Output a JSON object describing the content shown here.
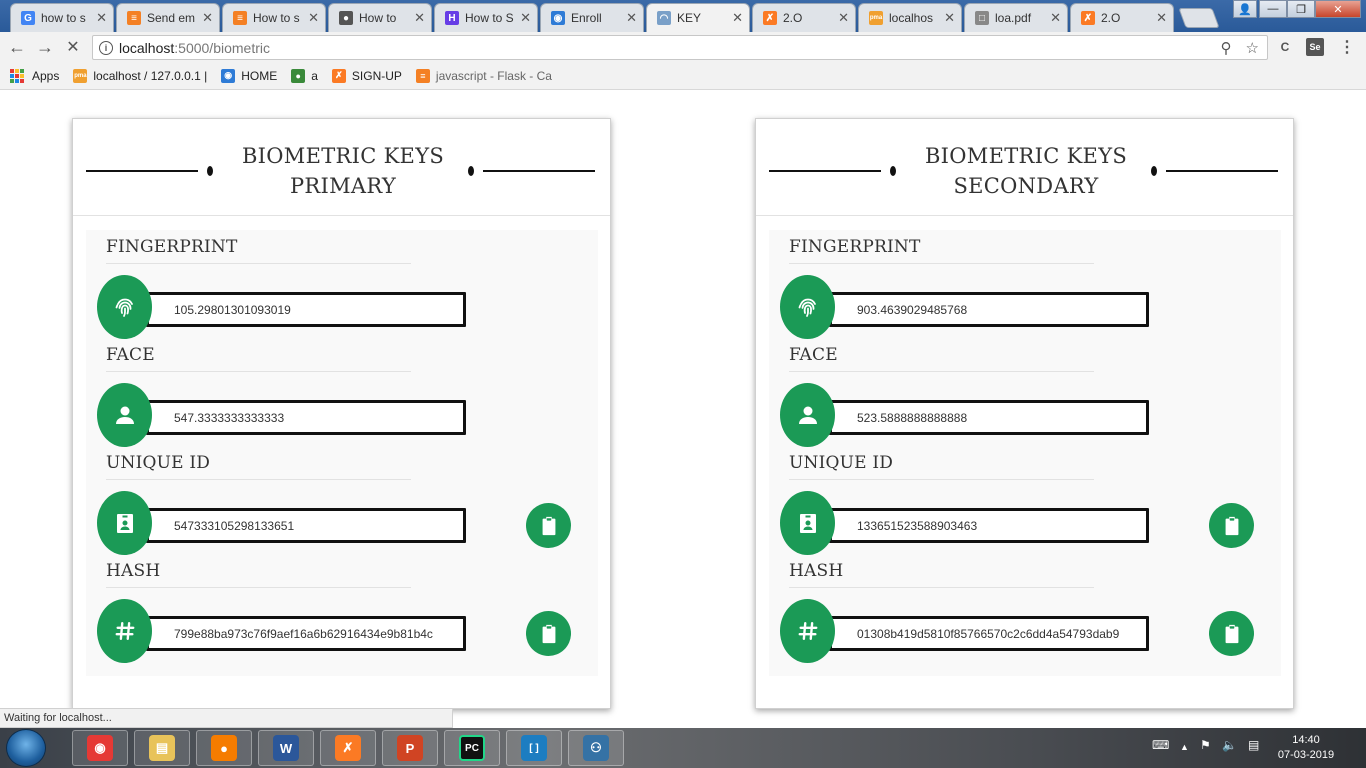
{
  "browser": {
    "tabs": [
      {
        "label": "how to s",
        "icon": "google-icon",
        "color": "#4285f4"
      },
      {
        "label": "Send em",
        "icon": "stackoverflow-icon",
        "color": "#f48024"
      },
      {
        "label": "How to s",
        "icon": "stackoverflow-icon",
        "color": "#f48024"
      },
      {
        "label": "How to",
        "icon": "github-icon",
        "color": "#555555"
      },
      {
        "label": "How to S",
        "icon": "hostinger-icon",
        "color": "#673de6"
      },
      {
        "label": "Enroll",
        "icon": "chrome-icon",
        "color": "#2e7bd6"
      },
      {
        "label": "KEY",
        "icon": "loading-icon",
        "color": "#7aa0c8"
      },
      {
        "label": "2.O",
        "icon": "xampp-icon",
        "color": "#fb7a24"
      },
      {
        "label": "localhos",
        "icon": "phpmyadmin-icon",
        "color": "#f0a030"
      },
      {
        "label": "loa.pdf",
        "icon": "document-icon",
        "color": "#888888"
      },
      {
        "label": "2.O",
        "icon": "xampp-icon",
        "color": "#fb7a24"
      }
    ],
    "active_tab_index": 6,
    "url_host": "localhost",
    "url_path": ":5000/biometric",
    "bookmarks": [
      {
        "label": "Apps",
        "icon": "apps-grid-icon"
      },
      {
        "label": "localhost / 127.0.0.1 |",
        "icon": "phpmyadmin-icon"
      },
      {
        "label": "HOME",
        "icon": "chrome-icon"
      },
      {
        "label": "a",
        "icon": "globe-icon"
      },
      {
        "label": "SIGN-UP",
        "icon": "xampp-icon"
      },
      {
        "label": "javascript - Flask - Ca",
        "icon": "stackoverflow-icon"
      }
    ]
  },
  "page": {
    "accent_color": "#1b9a56",
    "cards": [
      {
        "title": "BIOMETRIC KEYS PRIMARY",
        "sections": [
          {
            "label": "FINGERPRINT",
            "value": "105.29801301093019",
            "icon": "fingerprint-icon",
            "copyable": false
          },
          {
            "label": "FACE",
            "value": "547.3333333333333",
            "icon": "person-icon",
            "copyable": false
          },
          {
            "label": "UNIQUE ID",
            "value": "547333105298133651",
            "icon": "id-badge-icon",
            "copyable": true
          },
          {
            "label": "HASH",
            "value": "799e88ba973c76f9aef16a6b62916434e9b81b4c",
            "icon": "hash-icon",
            "copyable": true
          }
        ]
      },
      {
        "title": "BIOMETRIC KEYS SECONDARY",
        "sections": [
          {
            "label": "FINGERPRINT",
            "value": "903.4639029485768",
            "icon": "fingerprint-icon",
            "copyable": false
          },
          {
            "label": "FACE",
            "value": "523.5888888888888",
            "icon": "person-icon",
            "copyable": false
          },
          {
            "label": "UNIQUE ID",
            "value": "133651523588903463",
            "icon": "id-badge-icon",
            "copyable": true
          },
          {
            "label": "HASH",
            "value": "01308b419d5810f85766570c2c6dd4a54793dab9",
            "icon": "hash-icon",
            "copyable": true
          }
        ]
      }
    ]
  },
  "status_text": "Waiting for localhost...",
  "taskbar": {
    "apps": [
      "chrome-icon",
      "file-explorer-icon",
      "firefox-icon",
      "word-icon",
      "xampp-icon",
      "powerpoint-icon",
      "pycharm-icon",
      "brackets-icon",
      "python-icon"
    ],
    "time": "14:40",
    "date": "07-03-2019"
  }
}
